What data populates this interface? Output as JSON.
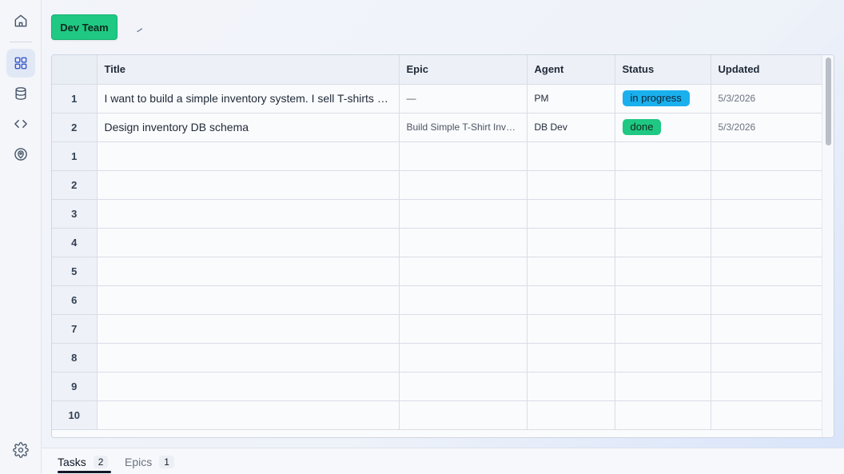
{
  "sidebar": {
    "items": [
      {
        "name": "home",
        "icon": "home-icon"
      },
      {
        "name": "board",
        "icon": "grid-icon",
        "active": true
      },
      {
        "name": "database",
        "icon": "database-icon"
      },
      {
        "name": "code",
        "icon": "code-icon"
      },
      {
        "name": "map",
        "icon": "map-pin-icon"
      },
      {
        "name": "settings",
        "icon": "gear-icon"
      }
    ]
  },
  "toolbar": {
    "team_label": "Dev Team",
    "accent_color": "#1fc883"
  },
  "table": {
    "columns": [
      "Title",
      "Epic",
      "Agent",
      "Status",
      "Updated"
    ],
    "rows": [
      {
        "num": "1",
        "title": "I want to build a simple inventory system. I sell T-shirts and need to track stock levels.",
        "epic": "—",
        "agent": "PM",
        "status": "in progress",
        "updated": "5/3/2026"
      },
      {
        "num": "2",
        "title": "Design inventory DB schema",
        "epic": "Build Simple T-Shirt Inventory System",
        "agent": "DB Dev",
        "status": "done",
        "updated": "5/3/2026"
      }
    ],
    "empty_rows": [
      "1",
      "2",
      "3",
      "4",
      "5",
      "6",
      "7",
      "8",
      "9",
      "10"
    ]
  },
  "tabs": [
    {
      "label": "Tasks",
      "count": "2",
      "active": true
    },
    {
      "label": "Epics",
      "count": "1",
      "active": false
    }
  ],
  "colors": {
    "in_progress": "#1ab0ee",
    "done": "#1fc883"
  }
}
